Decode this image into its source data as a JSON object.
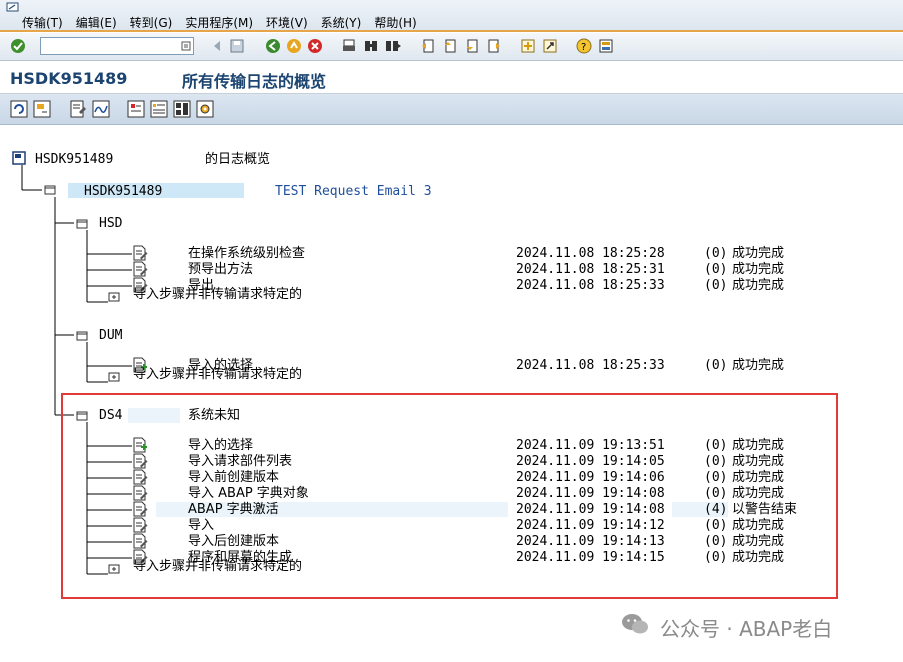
{
  "menu": [
    "传输(T)",
    "编辑(E)",
    "转到(G)",
    "实用程序(M)",
    "环境(V)",
    "系统(Y)",
    "帮助(H)"
  ],
  "title": {
    "id": "HSDK951489",
    "text": "所有传输日志的概览"
  },
  "tree": {
    "root": {
      "label": "HSDK951489",
      "suffix": "的日志概览"
    },
    "request": {
      "label": "HSDK951489",
      "description": "TEST Request Email 3"
    },
    "systems": [
      {
        "name": "HSD",
        "note": "",
        "steps": [
          {
            "label": "在操作系统级别检查",
            "time": "2024.11.08 18:25:28",
            "rc": "(0)",
            "status": "成功完成"
          },
          {
            "label": "预导出方法",
            "time": "2024.11.08 18:25:31",
            "rc": "(0)",
            "status": "成功完成"
          },
          {
            "label": "导出",
            "time": "2024.11.08 18:25:33",
            "rc": "(0)",
            "status": "成功完成"
          }
        ],
        "footer": "导入步骤并非传输请求特定的"
      },
      {
        "name": "DUM",
        "note": "",
        "steps": [
          {
            "label": "导入的选择",
            "time": "2024.11.08 18:25:33",
            "rc": "(0)",
            "status": "成功完成"
          }
        ],
        "footer": "导入步骤并非传输请求特定的"
      },
      {
        "name": "DS4",
        "note": "系统未知",
        "steps": [
          {
            "label": "导入的选择",
            "time": "2024.11.09 19:13:51",
            "rc": "(0)",
            "status": "成功完成"
          },
          {
            "label": "导入请求部件列表",
            "time": "2024.11.09 19:14:05",
            "rc": "(0)",
            "status": "成功完成"
          },
          {
            "label": "导入前创建版本",
            "time": "2024.11.09 19:14:06",
            "rc": "(0)",
            "status": "成功完成"
          },
          {
            "label": "导入 ABAP 字典对象",
            "time": "2024.11.09 19:14:08",
            "rc": "(0)",
            "status": "成功完成"
          },
          {
            "label": "ABAP 字典激活",
            "time": "2024.11.09 19:14:08",
            "rc": "(4)",
            "status": "以警告结束"
          },
          {
            "label": "导入",
            "time": "2024.11.09 19:14:12",
            "rc": "(0)",
            "status": "成功完成"
          },
          {
            "label": "导入后创建版本",
            "time": "2024.11.09 19:14:13",
            "rc": "(0)",
            "status": "成功完成"
          },
          {
            "label": "程序和屏幕的生成",
            "time": "2024.11.09 19:14:15",
            "rc": "(0)",
            "status": "成功完成"
          }
        ],
        "footer": "导入步骤并非传输请求特定的"
      }
    ]
  },
  "watermark": "公众号 · ABAP老白",
  "colors": {
    "accent": "#e7a54a",
    "title": "#1c4470",
    "highlight": "#e23a3a"
  }
}
